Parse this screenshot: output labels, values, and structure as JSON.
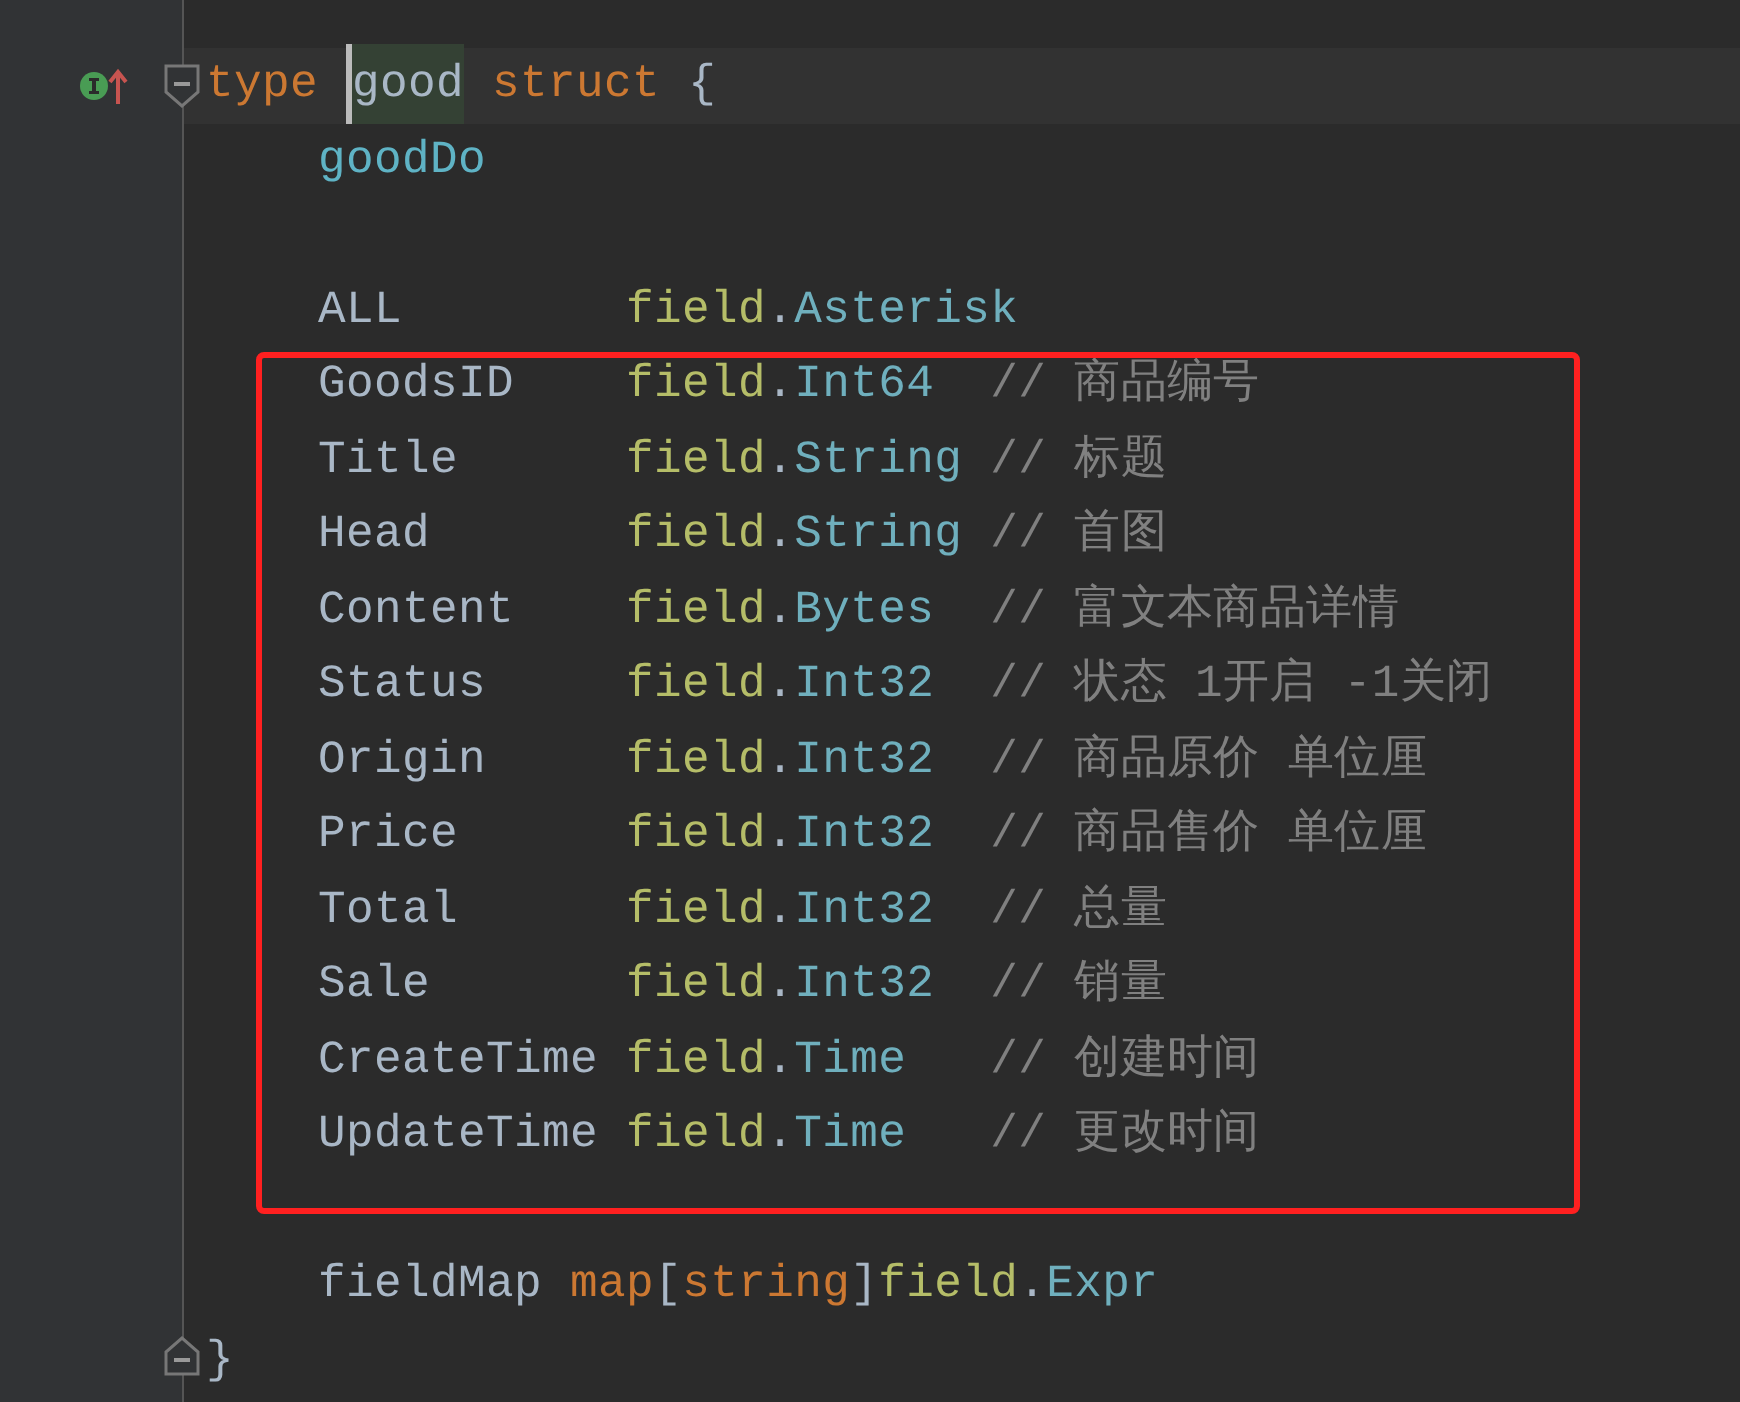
{
  "lines": [
    {
      "kind": "current",
      "gutter": [
        {
          "kind": "implemented"
        },
        {
          "kind": "fold-open"
        }
      ],
      "tokens": [
        {
          "text": "type ",
          "kind": "keyword"
        },
        {
          "text": "good",
          "kind": "usage"
        },
        {
          "text": " struct ",
          "kind": "keyword"
        },
        {
          "text": "{",
          "kind": "plain"
        }
      ]
    },
    {
      "kind": "code",
      "tokens": [
        {
          "text": "    goodDo",
          "kind": "embedded"
        }
      ]
    },
    {
      "kind": "blank"
    },
    {
      "kind": "code",
      "tokens": [
        {
          "text": "    ALL        ",
          "kind": "plain"
        },
        {
          "text": "field",
          "kind": "package"
        },
        {
          "text": ".",
          "kind": "plain"
        },
        {
          "text": "Asterisk",
          "kind": "type"
        }
      ]
    },
    {
      "kind": "boxed-group",
      "lines": [
        {
          "kind": "code",
          "tokens": [
            {
              "text": "    GoodsID    ",
              "kind": "plain"
            },
            {
              "text": "field",
              "kind": "package"
            },
            {
              "text": ".",
              "kind": "plain"
            },
            {
              "text": "Int64",
              "kind": "type"
            },
            {
              "text": "  // 商品编号",
              "kind": "comment"
            }
          ]
        },
        {
          "kind": "code",
          "tokens": [
            {
              "text": "    Title      ",
              "kind": "plain"
            },
            {
              "text": "field",
              "kind": "package"
            },
            {
              "text": ".",
              "kind": "plain"
            },
            {
              "text": "String",
              "kind": "type"
            },
            {
              "text": " // 标题",
              "kind": "comment"
            }
          ]
        },
        {
          "kind": "code",
          "tokens": [
            {
              "text": "    Head       ",
              "kind": "plain"
            },
            {
              "text": "field",
              "kind": "package"
            },
            {
              "text": ".",
              "kind": "plain"
            },
            {
              "text": "String",
              "kind": "type"
            },
            {
              "text": " // 首图",
              "kind": "comment"
            }
          ]
        },
        {
          "kind": "code",
          "tokens": [
            {
              "text": "    Content    ",
              "kind": "plain"
            },
            {
              "text": "field",
              "kind": "package"
            },
            {
              "text": ".",
              "kind": "plain"
            },
            {
              "text": "Bytes",
              "kind": "type"
            },
            {
              "text": "  // 富文本商品详情",
              "kind": "comment"
            }
          ]
        },
        {
          "kind": "code",
          "tokens": [
            {
              "text": "    Status     ",
              "kind": "plain"
            },
            {
              "text": "field",
              "kind": "package"
            },
            {
              "text": ".",
              "kind": "plain"
            },
            {
              "text": "Int32",
              "kind": "type"
            },
            {
              "text": "  // 状态 1开启 -1关闭",
              "kind": "comment"
            }
          ]
        },
        {
          "kind": "code",
          "tokens": [
            {
              "text": "    Origin     ",
              "kind": "plain"
            },
            {
              "text": "field",
              "kind": "package"
            },
            {
              "text": ".",
              "kind": "plain"
            },
            {
              "text": "Int32",
              "kind": "type"
            },
            {
              "text": "  // 商品原价 单位厘",
              "kind": "comment"
            }
          ]
        },
        {
          "kind": "code",
          "tokens": [
            {
              "text": "    Price      ",
              "kind": "plain"
            },
            {
              "text": "field",
              "kind": "package"
            },
            {
              "text": ".",
              "kind": "plain"
            },
            {
              "text": "Int32",
              "kind": "type"
            },
            {
              "text": "  // 商品售价 单位厘",
              "kind": "comment"
            }
          ]
        },
        {
          "kind": "code",
          "tokens": [
            {
              "text": "    Total      ",
              "kind": "plain"
            },
            {
              "text": "field",
              "kind": "package"
            },
            {
              "text": ".",
              "kind": "plain"
            },
            {
              "text": "Int32",
              "kind": "type"
            },
            {
              "text": "  // 总量",
              "kind": "comment"
            }
          ]
        },
        {
          "kind": "code",
          "tokens": [
            {
              "text": "    Sale       ",
              "kind": "plain"
            },
            {
              "text": "field",
              "kind": "package"
            },
            {
              "text": ".",
              "kind": "plain"
            },
            {
              "text": "Int32",
              "kind": "type"
            },
            {
              "text": "  // 销量",
              "kind": "comment"
            }
          ]
        },
        {
          "kind": "code",
          "tokens": [
            {
              "text": "    CreateTime ",
              "kind": "plain"
            },
            {
              "text": "field",
              "kind": "package"
            },
            {
              "text": ".",
              "kind": "plain"
            },
            {
              "text": "Time",
              "kind": "type"
            },
            {
              "text": "   // 创建时间",
              "kind": "comment"
            }
          ]
        },
        {
          "kind": "code",
          "tokens": [
            {
              "text": "    UpdateTime ",
              "kind": "plain"
            },
            {
              "text": "field",
              "kind": "package"
            },
            {
              "text": ".",
              "kind": "plain"
            },
            {
              "text": "Time",
              "kind": "type"
            },
            {
              "text": "   // 更改时间",
              "kind": "comment"
            }
          ]
        }
      ]
    },
    {
      "kind": "blank"
    },
    {
      "kind": "code",
      "tokens": [
        {
          "text": "    fieldMap ",
          "kind": "plain"
        },
        {
          "text": "map",
          "kind": "keyword"
        },
        {
          "text": "[",
          "kind": "plain"
        },
        {
          "text": "string",
          "kind": "keyword"
        },
        {
          "text": "]",
          "kind": "plain"
        },
        {
          "text": "field",
          "kind": "package"
        },
        {
          "text": ".",
          "kind": "plain"
        },
        {
          "text": "Expr",
          "kind": "type"
        }
      ]
    },
    {
      "kind": "code",
      "gutter": [
        {
          "kind": "fold-close"
        }
      ],
      "tokens": [
        {
          "text": "}",
          "kind": "plain"
        }
      ]
    }
  ]
}
